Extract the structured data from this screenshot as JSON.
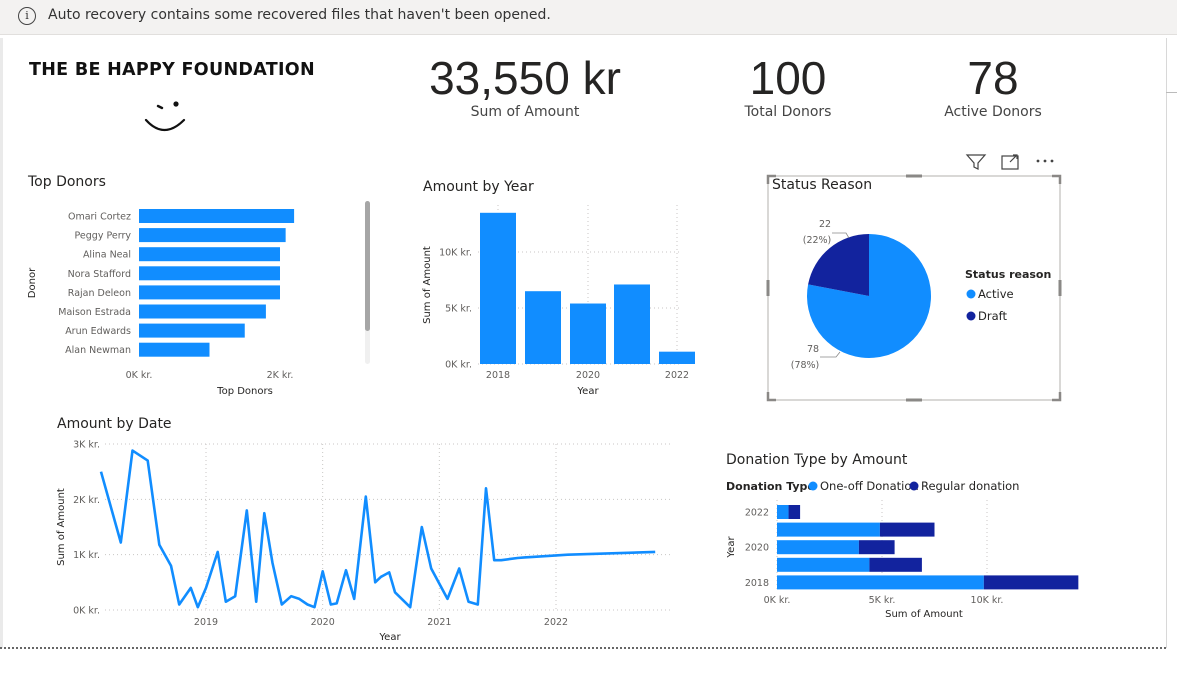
{
  "banner": {
    "message": "Auto recovery contains some recovered files that haven't been opened."
  },
  "report_title": "THE BE HAPPY FOUNDATION",
  "kpis": [
    {
      "value": "33,550 kr",
      "label": "Sum of Amount"
    },
    {
      "value": "100",
      "label": "Total Donors"
    },
    {
      "value": "78",
      "label": "Active Donors"
    }
  ],
  "colors": {
    "primary": "#118DFF",
    "secondary": "#12239E",
    "banner_bg": "#f3f2f1"
  },
  "chart_data": [
    {
      "id": "top_donors",
      "type": "bar",
      "orientation": "horizontal",
      "title": "Top Donors",
      "xlabel": "Top Donors",
      "ylabel": "Donor",
      "categories": [
        "Omari Cortez",
        "Peggy Perry",
        "Alina Neal",
        "Nora Stafford",
        "Rajan Deleon",
        "Maison Estrada",
        "Arun Edwards",
        "Alan Newman"
      ],
      "values": [
        2200,
        2080,
        2000,
        2000,
        2000,
        1800,
        1500,
        1000
      ],
      "xlim": [
        0,
        2000
      ],
      "xticks": [
        "0K kr.",
        "2K kr."
      ]
    },
    {
      "id": "amount_by_year",
      "type": "bar",
      "title": "Amount by Year",
      "xlabel": "Year",
      "ylabel": "Sum of Amount",
      "categories": [
        2018,
        2019,
        2020,
        2021,
        2022
      ],
      "values": [
        13500,
        6500,
        5400,
        7100,
        1100
      ],
      "xticks": [
        "2018",
        "2020",
        "2022"
      ],
      "yticks": [
        "0K kr.",
        "5K kr.",
        "10K kr."
      ],
      "ylim": [
        0,
        10000
      ]
    },
    {
      "id": "status_reason",
      "type": "pie",
      "title": "Status Reason",
      "legend_title": "Status reason",
      "legend_position": "right",
      "slices": [
        {
          "name": "Active",
          "value": 78,
          "label": "78",
          "pct": "(78%)"
        },
        {
          "name": "Draft",
          "value": 22,
          "label": "22",
          "pct": "(22%)"
        }
      ]
    },
    {
      "id": "amount_by_date",
      "type": "line",
      "title": "Amount by Date",
      "xlabel": "Year",
      "ylabel": "Sum of Amount",
      "xticks": [
        "2019",
        "2020",
        "2021",
        "2022"
      ],
      "yticks": [
        "0K kr.",
        "1K kr.",
        "2K kr.",
        "3K kr."
      ],
      "ylim": [
        0,
        3000
      ],
      "x": [
        2018.1,
        2018.27,
        2018.37,
        2018.5,
        2018.6,
        2018.7,
        2018.77,
        2018.87,
        2018.93,
        2019.0,
        2019.1,
        2019.17,
        2019.25,
        2019.35,
        2019.43,
        2019.5,
        2019.57,
        2019.65,
        2019.73,
        2019.8,
        2019.87,
        2019.93,
        2020.0,
        2020.07,
        2020.12,
        2020.2,
        2020.27,
        2020.37,
        2020.45,
        2020.5,
        2020.57,
        2020.62,
        2020.75,
        2020.85,
        2020.93,
        2021.07,
        2021.17,
        2021.25,
        2021.33,
        2021.4,
        2021.47,
        2021.53,
        2021.6,
        2021.67,
        2021.73,
        2021.8,
        2022.1,
        2022.85
      ],
      "y": [
        2500,
        1220,
        2880,
        2700,
        1180,
        800,
        100,
        400,
        50,
        400,
        1050,
        150,
        250,
        1800,
        150,
        1750,
        850,
        100,
        250,
        200,
        100,
        50,
        700,
        100,
        120,
        720,
        200,
        2050,
        500,
        600,
        680,
        320,
        50,
        1500,
        750,
        200,
        750,
        150,
        100,
        2200,
        900,
        900,
        920,
        940,
        950,
        960,
        1000,
        1050
      ]
    },
    {
      "id": "donation_type_by_amount",
      "type": "bar",
      "orientation": "horizontal",
      "stacked": true,
      "title": "Donation Type by Amount",
      "legend_title": "Donation Type",
      "legend_position": "top",
      "xlabel": "Sum of Amount",
      "ylabel": "Year",
      "categories": [
        2022,
        2021,
        2020,
        2019,
        2018
      ],
      "yticks": [
        "2022",
        "2020",
        "2018"
      ],
      "xticks": [
        "0K kr.",
        "5K kr.",
        "10K kr."
      ],
      "xlim": [
        0,
        10000
      ],
      "series": [
        {
          "name": "One-off Donation",
          "values": [
            550,
            4900,
            3900,
            4400,
            9850
          ]
        },
        {
          "name": "Regular donation",
          "values": [
            550,
            2600,
            1700,
            2500,
            4500
          ]
        }
      ]
    }
  ]
}
